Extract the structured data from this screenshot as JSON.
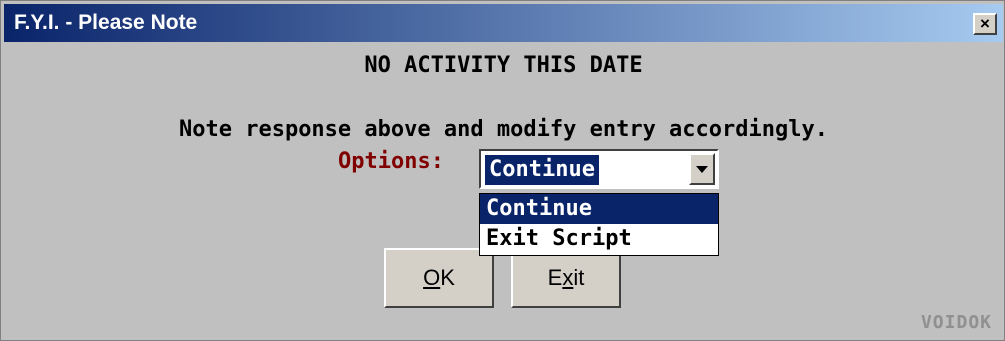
{
  "window": {
    "title": "F.Y.I. - Please Note",
    "close_label": "×"
  },
  "dialog": {
    "heading": "NO ACTIVITY THIS DATE",
    "note": "Note response above and modify entry accordingly.",
    "options_label": "Options:",
    "selected_option": "Continue",
    "options": [
      "Continue",
      "Exit Script"
    ]
  },
  "buttons": {
    "ok": {
      "mnemonic": "O",
      "rest": "K"
    },
    "exit": {
      "before": "E",
      "mnemonic": "x",
      "rest": "it"
    }
  },
  "watermark": "VOIDOK",
  "colors": {
    "title_bar_start": "#0a246a",
    "title_bar_end": "#a6caf0",
    "options_label": "#800000",
    "highlight": "#0a246a",
    "dialog_bg": "#c0c0c0"
  },
  "icons": {
    "close": "close-icon",
    "dropdown": "chevron-down-icon"
  }
}
